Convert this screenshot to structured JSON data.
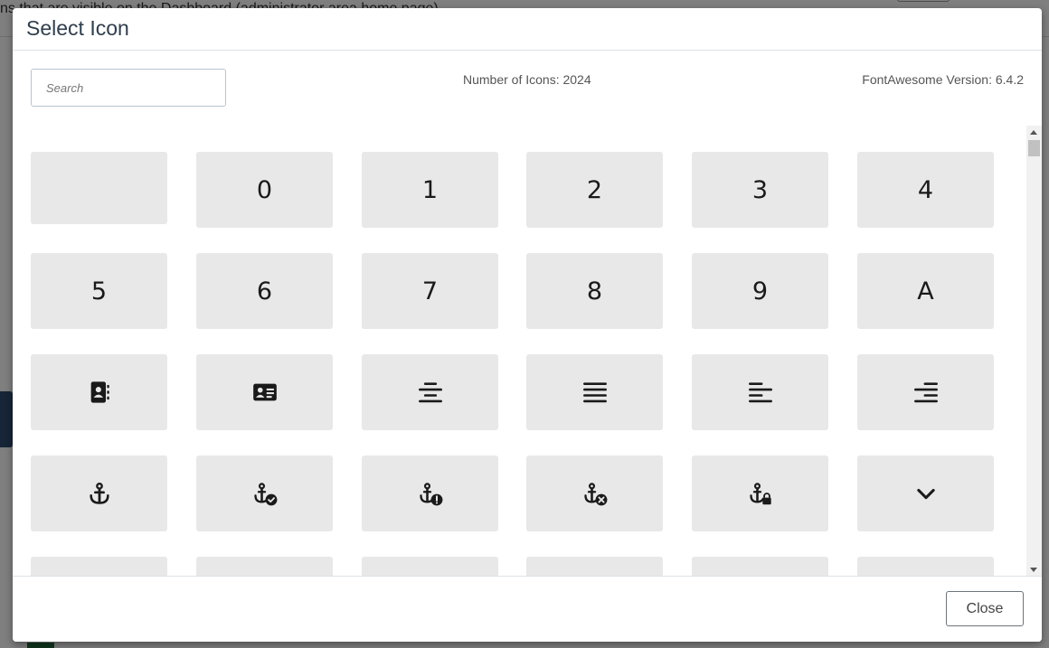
{
  "background": {
    "partial_text": "ns that are visible on the Dashboard (administrator area home page)"
  },
  "modal": {
    "title": "Select Icon",
    "search": {
      "placeholder": "Search",
      "value": ""
    },
    "icon_count_text": "Number of Icons: 2024",
    "version_text": "FontAwesome Version: 6.4.2",
    "close_label": "Close"
  },
  "icons": [
    {
      "name": "blank-icon",
      "text": ""
    },
    {
      "name": "digit-0-icon",
      "text": "0"
    },
    {
      "name": "digit-1-icon",
      "text": "1"
    },
    {
      "name": "digit-2-icon",
      "text": "2"
    },
    {
      "name": "digit-3-icon",
      "text": "3"
    },
    {
      "name": "digit-4-icon",
      "text": "4"
    },
    {
      "name": "digit-5-icon",
      "text": "5"
    },
    {
      "name": "digit-6-icon",
      "text": "6"
    },
    {
      "name": "digit-7-icon",
      "text": "7"
    },
    {
      "name": "digit-8-icon",
      "text": "8"
    },
    {
      "name": "digit-9-icon",
      "text": "9"
    },
    {
      "name": "letter-a-icon",
      "text": "A"
    },
    {
      "name": "address-book-icon",
      "text": ""
    },
    {
      "name": "address-card-icon",
      "text": ""
    },
    {
      "name": "align-center-icon",
      "text": ""
    },
    {
      "name": "align-justify-icon",
      "text": ""
    },
    {
      "name": "align-left-icon",
      "text": ""
    },
    {
      "name": "align-right-icon",
      "text": ""
    },
    {
      "name": "anchor-icon",
      "text": ""
    },
    {
      "name": "anchor-circle-check-icon",
      "text": ""
    },
    {
      "name": "anchor-circle-exclamation-icon",
      "text": ""
    },
    {
      "name": "anchor-circle-xmark-icon",
      "text": ""
    },
    {
      "name": "anchor-lock-icon",
      "text": ""
    },
    {
      "name": "angle-down-icon",
      "text": ""
    }
  ]
}
